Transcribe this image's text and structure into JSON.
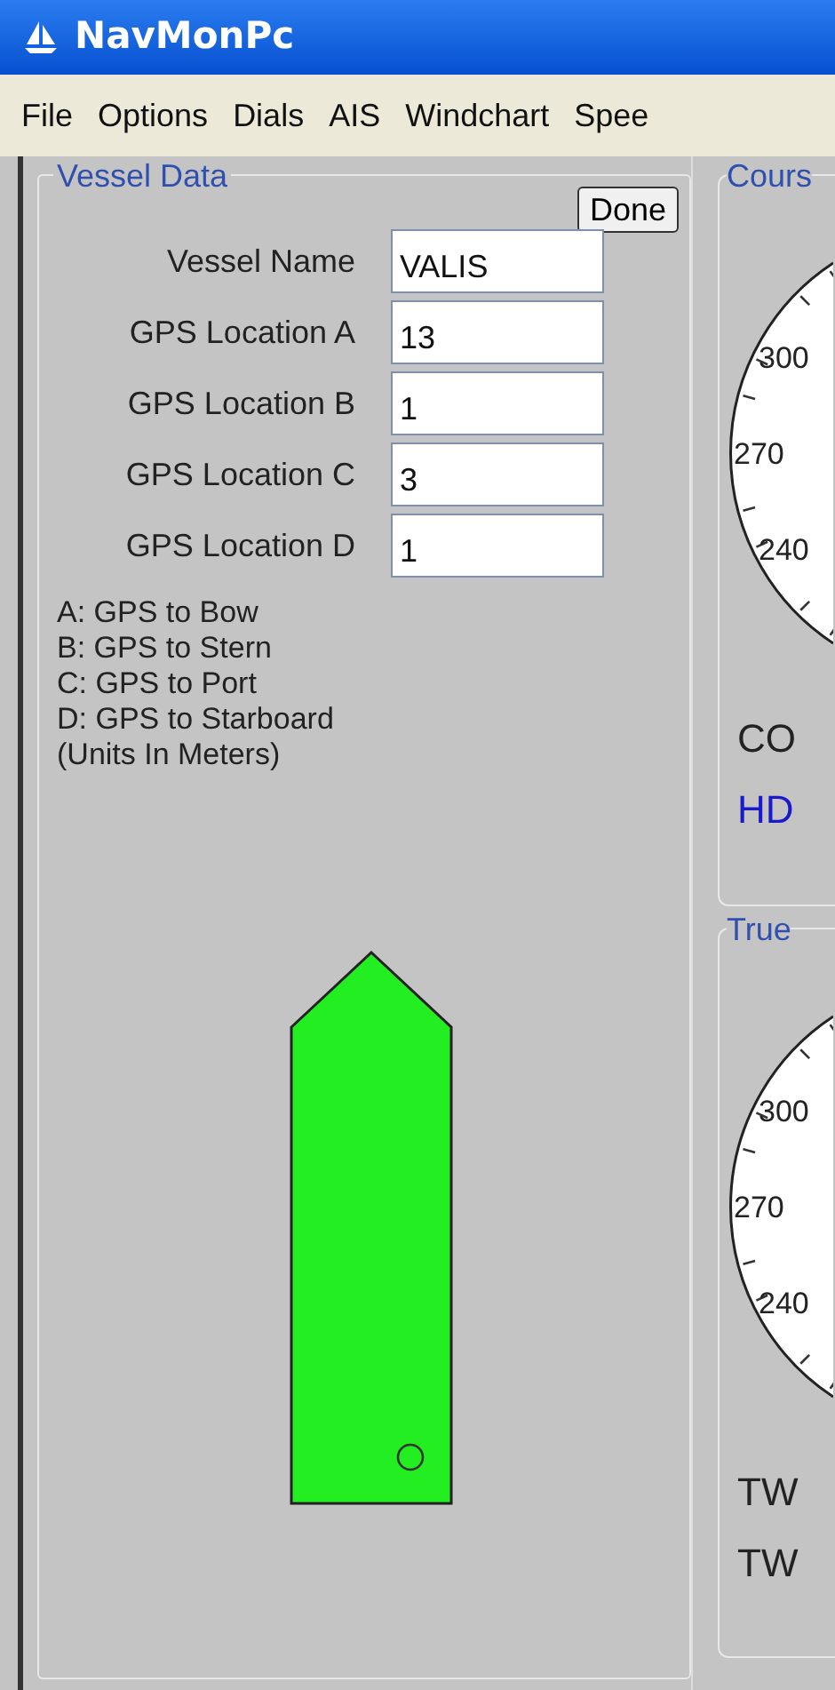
{
  "window": {
    "title": "NavMonPc"
  },
  "menu": [
    "File",
    "Options",
    "Dials",
    "AIS",
    "Windchart",
    "Spee"
  ],
  "vessel_data": {
    "title": "Vessel Data",
    "done_button": "Done",
    "fields": [
      {
        "label": "Vessel Name",
        "value": "VALIS"
      },
      {
        "label": "GPS Location A",
        "value": "13"
      },
      {
        "label": "GPS Location B",
        "value": "1"
      },
      {
        "label": "GPS Location C",
        "value": "3"
      },
      {
        "label": "GPS Location D",
        "value": "1"
      }
    ],
    "legend": [
      "A: GPS to Bow",
      "B: GPS to Stern",
      "C: GPS to Port",
      "D: GPS to Starboard",
      "(Units In Meters)"
    ]
  },
  "dials": [
    {
      "title": "Cours",
      "ticks": [
        "300",
        "270",
        "240"
      ],
      "readouts": [
        {
          "text": "CO",
          "color": "#222222"
        },
        {
          "text": "HD",
          "color": "#1a1acc"
        }
      ]
    },
    {
      "title": "True",
      "ticks": [
        "300",
        "270",
        "240"
      ],
      "readouts": [
        {
          "text": "TW",
          "color": "#222222"
        },
        {
          "text": "TW",
          "color": "#222222"
        }
      ]
    }
  ]
}
